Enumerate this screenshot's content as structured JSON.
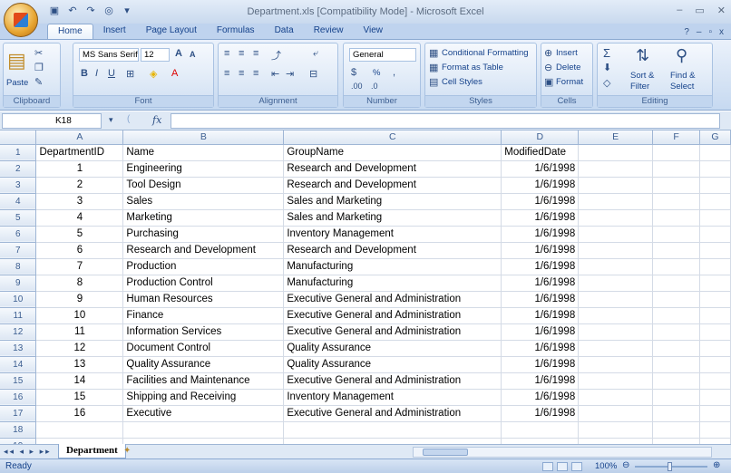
{
  "window": {
    "title": "Department.xls  [Compatibility Mode] - Microsoft Excel"
  },
  "ribbon_tabs": [
    "Home",
    "Insert",
    "Page Layout",
    "Formulas",
    "Data",
    "Review",
    "View"
  ],
  "clipboard": {
    "paste": "Paste",
    "label": "Clipboard"
  },
  "font": {
    "name": "MS Sans Serif",
    "size": "12",
    "label": "Font"
  },
  "alignment": {
    "label": "Alignment"
  },
  "number": {
    "format": "General",
    "percent": "%",
    "label": "Number"
  },
  "styles": {
    "conditional": "Conditional Formatting",
    "format_table": "Format as Table",
    "cell_styles": "Cell Styles",
    "label": "Styles"
  },
  "cells": {
    "insert": "Insert",
    "delete": "Delete",
    "format": "Format",
    "label": "Cells"
  },
  "editing": {
    "sort": "Sort &",
    "filter": "Filter",
    "find": "Find &",
    "select": "Select",
    "label": "Editing"
  },
  "name_box": "K18",
  "columns": [
    "A",
    "B",
    "C",
    "D",
    "E",
    "F",
    "G"
  ],
  "rows": [
    {
      "n": "1",
      "a": "DepartmentID",
      "b": "Name",
      "c": "GroupName",
      "d": "ModifiedDate"
    },
    {
      "n": "2",
      "a": "1",
      "b": "Engineering",
      "c": "Research and Development",
      "d": "1/6/1998"
    },
    {
      "n": "3",
      "a": "2",
      "b": "Tool Design",
      "c": "Research and Development",
      "d": "1/6/1998"
    },
    {
      "n": "4",
      "a": "3",
      "b": "Sales",
      "c": "Sales and Marketing",
      "d": "1/6/1998"
    },
    {
      "n": "5",
      "a": "4",
      "b": "Marketing",
      "c": "Sales and Marketing",
      "d": "1/6/1998"
    },
    {
      "n": "6",
      "a": "5",
      "b": "Purchasing",
      "c": "Inventory Management",
      "d": "1/6/1998"
    },
    {
      "n": "7",
      "a": "6",
      "b": "Research and Development",
      "c": "Research and Development",
      "d": "1/6/1998"
    },
    {
      "n": "8",
      "a": "7",
      "b": "Production",
      "c": "Manufacturing",
      "d": "1/6/1998"
    },
    {
      "n": "9",
      "a": "8",
      "b": "Production Control",
      "c": "Manufacturing",
      "d": "1/6/1998"
    },
    {
      "n": "10",
      "a": "9",
      "b": "Human Resources",
      "c": "Executive General and Administration",
      "d": "1/6/1998"
    },
    {
      "n": "11",
      "a": "10",
      "b": "Finance",
      "c": "Executive General and Administration",
      "d": "1/6/1998"
    },
    {
      "n": "12",
      "a": "11",
      "b": "Information Services",
      "c": "Executive General and Administration",
      "d": "1/6/1998"
    },
    {
      "n": "13",
      "a": "12",
      "b": "Document Control",
      "c": "Quality Assurance",
      "d": "1/6/1998"
    },
    {
      "n": "14",
      "a": "13",
      "b": "Quality Assurance",
      "c": "Quality Assurance",
      "d": "1/6/1998"
    },
    {
      "n": "15",
      "a": "14",
      "b": "Facilities and Maintenance",
      "c": "Executive General and Administration",
      "d": "1/6/1998"
    },
    {
      "n": "16",
      "a": "15",
      "b": "Shipping and Receiving",
      "c": "Inventory Management",
      "d": "1/6/1998"
    },
    {
      "n": "17",
      "a": "16",
      "b": "Executive",
      "c": "Executive General and Administration",
      "d": "1/6/1998"
    },
    {
      "n": "18",
      "a": "",
      "b": "",
      "c": "",
      "d": ""
    },
    {
      "n": "19",
      "a": "",
      "b": "",
      "c": "",
      "d": ""
    }
  ],
  "sheet_tab": "Department",
  "status": {
    "text": "Ready",
    "zoom": "100%"
  }
}
